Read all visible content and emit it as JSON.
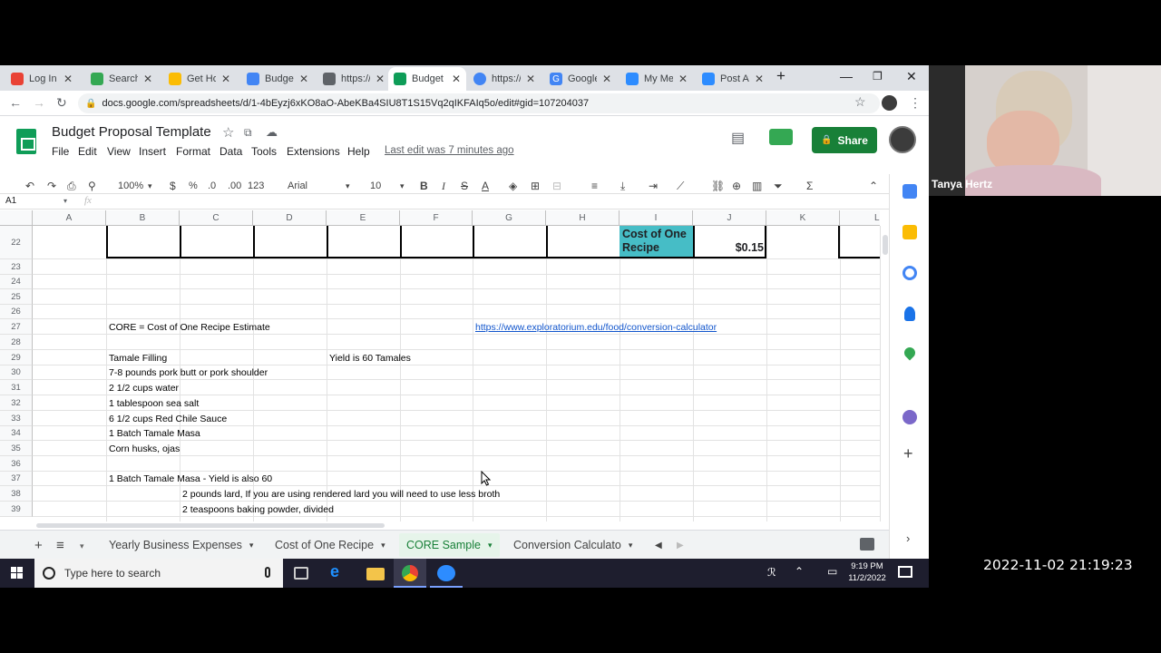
{
  "browser": {
    "tabs": [
      {
        "title": "Log In",
        "color": "#e94235"
      },
      {
        "title": "Search",
        "color": "#34a853"
      },
      {
        "title": "Get Ho",
        "color": "#fbbc04"
      },
      {
        "title": "Budget",
        "color": "#4285f4"
      },
      {
        "title": "https://",
        "color": "#5f6368"
      },
      {
        "title": "Budget",
        "color": "#0f9d58"
      },
      {
        "title": "https://",
        "color": "#4285f4"
      },
      {
        "title": "Google",
        "color": "#4285f4"
      },
      {
        "title": "My Me",
        "color": "#2d8cff"
      },
      {
        "title": "Post At",
        "color": "#2d8cff"
      }
    ],
    "new_tab": "+",
    "minimize": "—",
    "maximize": "❐",
    "close": "✕",
    "url": "docs.google.com/spreadsheets/d/1-4bEyzj6xKO8aO-AbeKBa4SIU8T1S15Vq2qIKFAIq5o/edit#gid=107204037"
  },
  "doc": {
    "title": "Budget Proposal Template",
    "menus": [
      "File",
      "Edit",
      "View",
      "Insert",
      "Format",
      "Data",
      "Tools",
      "Extensions",
      "Help"
    ],
    "last_edit": "Last edit was 7 minutes ago",
    "share_label": "Share"
  },
  "toolbar": {
    "zoom": "100%",
    "currency": "$",
    "percent": "%",
    "dec_less": ".0",
    "dec_more": ".00",
    "number_format": "123",
    "font": "Arial",
    "font_size": "10",
    "bold": "B",
    "italic": "I",
    "strike": "S",
    "text_color": "A"
  },
  "formula_bar": {
    "cell_ref": "A1",
    "fx": "fx"
  },
  "grid": {
    "columns": [
      "A",
      "B",
      "C",
      "D",
      "E",
      "F",
      "G",
      "H",
      "I",
      "J",
      "K",
      "L"
    ],
    "rows": [
      "22",
      "23",
      "24",
      "25",
      "26",
      "27",
      "28",
      "29",
      "30",
      "31",
      "32",
      "33",
      "34",
      "35",
      "36",
      "37",
      "38",
      "39"
    ],
    "highlight_label": "Cost of One Recipe",
    "highlight_value": "$0.15",
    "core_def": "CORE = Cost of One Recipe Estimate",
    "link": "https://www.exploratorium.edu/food/conversion-calculator",
    "filling_title": "Tamale Filling",
    "yield": "Yield is 60 Tamales",
    "ingredients": [
      "7-8 pounds pork butt or pork shoulder",
      "2 1/2 cups water",
      "1 tablespoon sea salt",
      "6 1/2 cups Red Chile Sauce",
      "1 Batch Tamale Masa",
      "Corn husks, ojas"
    ],
    "masa_title": "1 Batch Tamale Masa - Yield is also 60",
    "masa_lines": [
      "2 pounds lard, If you are using rendered lard you will need to use less broth",
      "2 teaspoons baking powder, divided"
    ]
  },
  "sheet_tabs": {
    "add": "+",
    "list": "≡",
    "tabs": [
      "Yearly Business Expenses",
      "Cost of One Recipe",
      "CORE Sample",
      "Conversion Calculato"
    ],
    "active": "CORE Sample"
  },
  "taskbar": {
    "search_placeholder": "Type here to search",
    "time": "9:19 PM",
    "date": "11/2/2022"
  },
  "video": {
    "name": "Tanya Hertz"
  },
  "timestamp": "2022-11-02  21:19:23",
  "colors": {
    "highlight": "#46bdc6",
    "sheets_green": "#188038",
    "link": "#1155cc"
  }
}
